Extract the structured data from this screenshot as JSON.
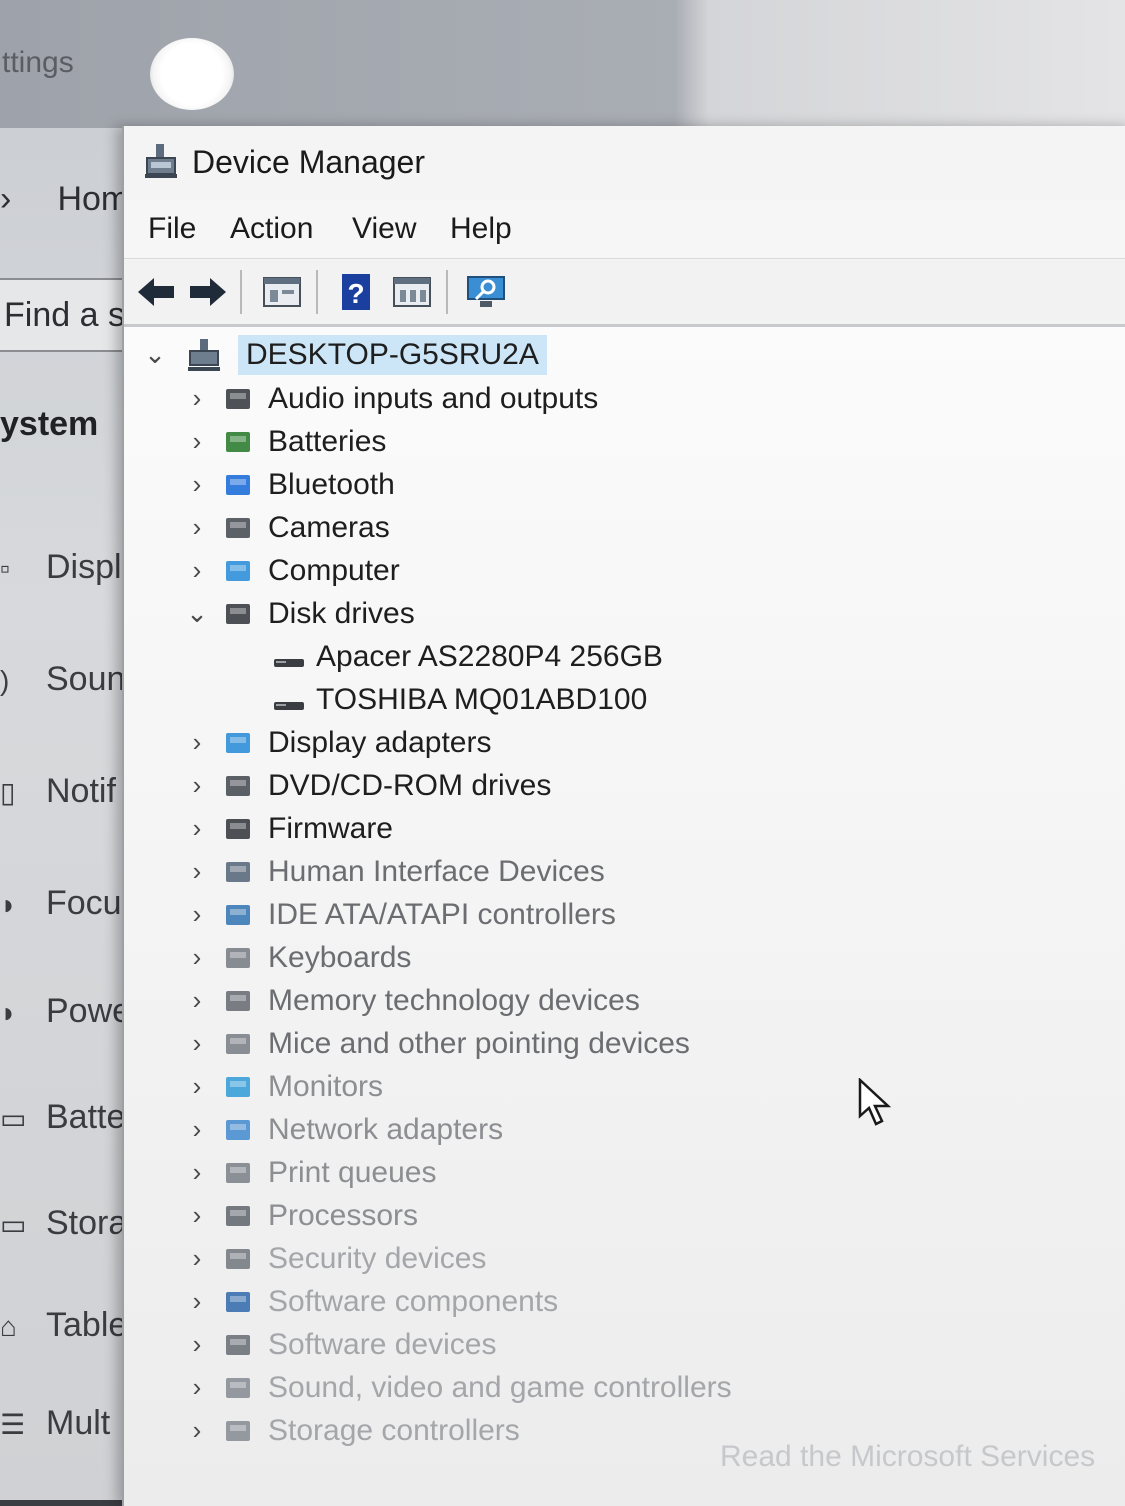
{
  "settings": {
    "title": "ttings",
    "home": "Hom",
    "search": "Find a s",
    "section": "ystem",
    "nav": [
      "Displ",
      "Soun",
      "Notif",
      "Focu",
      "Powe",
      "Batte",
      "Stora",
      "Table",
      "Mult"
    ]
  },
  "device_manager": {
    "title": "Device Manager",
    "menu": [
      "File",
      "Action",
      "View",
      "Help"
    ],
    "toolbar_icons": [
      "back-arrow-icon",
      "forward-arrow-icon",
      "properties-icon",
      "help-icon",
      "show-hidden-icon",
      "scan-hardware-icon"
    ],
    "root": "DESKTOP-G5SRU2A",
    "categories": [
      {
        "label": "Audio inputs and outputs",
        "icon": "speaker-icon",
        "expanded": false
      },
      {
        "label": "Batteries",
        "icon": "battery-icon",
        "expanded": false
      },
      {
        "label": "Bluetooth",
        "icon": "bluetooth-icon",
        "expanded": false
      },
      {
        "label": "Cameras",
        "icon": "camera-icon",
        "expanded": false
      },
      {
        "label": "Computer",
        "icon": "computer-icon",
        "expanded": false
      },
      {
        "label": "Disk drives",
        "icon": "disk-drive-icon",
        "expanded": true
      },
      {
        "label": "Display adapters",
        "icon": "display-adapter-icon",
        "expanded": false
      },
      {
        "label": "DVD/CD-ROM drives",
        "icon": "dvd-drive-icon",
        "expanded": false
      },
      {
        "label": "Firmware",
        "icon": "firmware-icon",
        "expanded": false
      },
      {
        "label": "Human Interface Devices",
        "icon": "hid-icon",
        "expanded": false
      },
      {
        "label": "IDE ATA/ATAPI controllers",
        "icon": "ide-controller-icon",
        "expanded": false
      },
      {
        "label": "Keyboards",
        "icon": "keyboard-icon",
        "expanded": false
      },
      {
        "label": "Memory technology devices",
        "icon": "memory-icon",
        "expanded": false
      },
      {
        "label": "Mice and other pointing devices",
        "icon": "mouse-icon",
        "expanded": false
      },
      {
        "label": "Monitors",
        "icon": "monitor-icon",
        "expanded": false
      },
      {
        "label": "Network adapters",
        "icon": "network-icon",
        "expanded": false
      },
      {
        "label": "Print queues",
        "icon": "printer-icon",
        "expanded": false
      },
      {
        "label": "Processors",
        "icon": "processor-icon",
        "expanded": false
      },
      {
        "label": "Security devices",
        "icon": "security-icon",
        "expanded": false
      },
      {
        "label": "Software components",
        "icon": "software-component-icon",
        "expanded": false
      },
      {
        "label": "Software devices",
        "icon": "software-device-icon",
        "expanded": false
      },
      {
        "label": "Sound, video and game controllers",
        "icon": "sound-controller-icon",
        "expanded": false
      },
      {
        "label": "Storage controllers",
        "icon": "storage-controller-icon",
        "expanded": false
      }
    ],
    "disk_drives": [
      "Apacer AS2280P4 256GB",
      "TOSHIBA MQ01ABD100"
    ]
  },
  "footer_text": "Read the Microsoft Services"
}
